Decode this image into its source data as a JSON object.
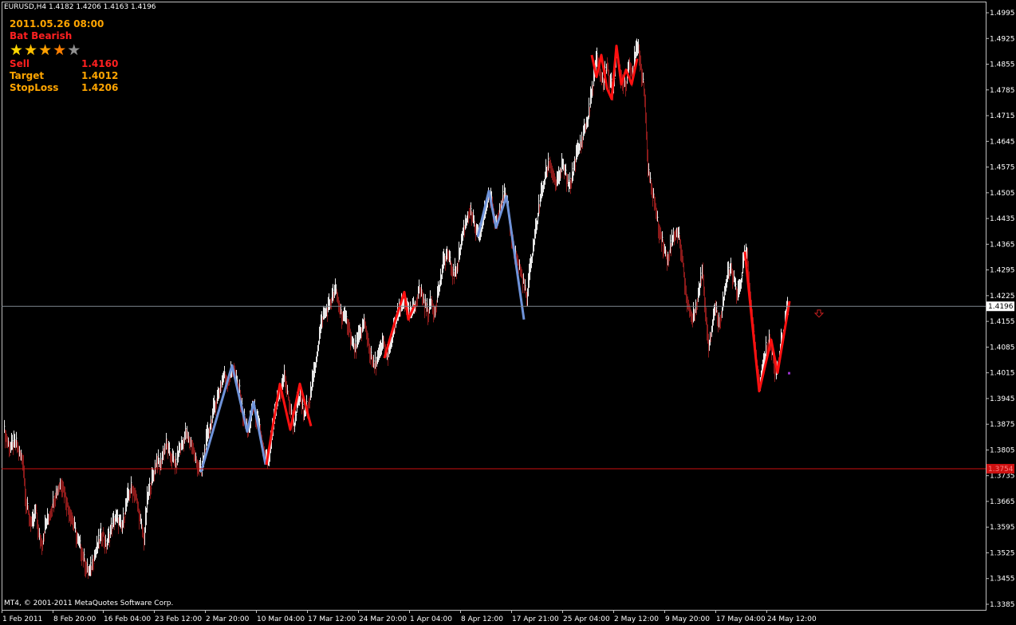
{
  "header": {
    "symbol_line": "EURUSD,H4  1.4182 1.4206 1.4163 1.4196"
  },
  "copyright": "MT4, © 2001-2011 MetaQuotes Software Corp.",
  "panel": {
    "datetime": "2011.05.26 08:00",
    "pattern": "Bat Bearish",
    "stars": [
      {
        "glyph": "★",
        "color": "#ffd700"
      },
      {
        "glyph": "★",
        "color": "#ffc000"
      },
      {
        "glyph": "★",
        "color": "#ffa000"
      },
      {
        "glyph": "★",
        "color": "#ff8000"
      },
      {
        "glyph": "★",
        "color": "#909090"
      }
    ],
    "sell": {
      "label": "Sell",
      "value": "1.4160"
    },
    "target": {
      "label": "Target",
      "value": "1.4012"
    },
    "stoploss": {
      "label": "StopLoss",
      "value": "1.4206"
    }
  },
  "colors": {
    "background": "#000000",
    "axis": "#c0c0c0",
    "text": "#ffffff",
    "bull": "#e8e8e8",
    "bear": "#8b1a1a",
    "pattern_blue": "#6f93d9",
    "pattern_red": "#ff1010",
    "current_price_line": "#7f8790",
    "level_line": "#cc1010",
    "level_label_bg": "#cc1010",
    "signal_arrow": "#c82020",
    "dot": "#9932cc"
  },
  "chart_data": {
    "type": "line",
    "title": "",
    "ylim": [
      1.338,
      1.5035
    ],
    "y_ticks": [
      "1.4995",
      "1.4925",
      "1.4855",
      "1.4785",
      "1.4715",
      "1.4645",
      "1.4575",
      "1.4505",
      "1.4435",
      "1.4365",
      "1.4295",
      "1.4225",
      "1.4155",
      "1.4085",
      "1.4015",
      "1.3945",
      "1.3875",
      "1.3805",
      "1.3735",
      "1.3665",
      "1.3595",
      "1.3525",
      "1.3455",
      "1.3385"
    ],
    "x_ticks": [
      "1 Feb 2011",
      "8 Feb 20:00",
      "16 Feb 04:00",
      "23 Feb 12:00",
      "2 Mar 20:00",
      "10 Mar 04:00",
      "17 Mar 12:00",
      "24 Mar 20:00",
      "1 Apr 04:00",
      "8 Apr 12:00",
      "17 Apr 21:00",
      "25 Apr 04:00",
      "2 May 12:00",
      "9 May 20:00",
      "17 May 04:00",
      "24 May 12:00"
    ],
    "current_price": {
      "label": "1.4196",
      "value": 1.4196
    },
    "level": {
      "label": "1.3754",
      "value": 1.3754
    },
    "close_path": [
      [
        0,
        1.386
      ],
      [
        4,
        1.383
      ],
      [
        8,
        1.381
      ],
      [
        12,
        1.382
      ],
      [
        16,
        1.382
      ],
      [
        20,
        1.379
      ],
      [
        24,
        1.378
      ],
      [
        28,
        1.366
      ],
      [
        32,
        1.362
      ],
      [
        36,
        1.36
      ],
      [
        40,
        1.364
      ],
      [
        44,
        1.357
      ],
      [
        48,
        1.355
      ],
      [
        52,
        1.36
      ],
      [
        56,
        1.362
      ],
      [
        60,
        1.365
      ],
      [
        64,
        1.368
      ],
      [
        68,
        1.37
      ],
      [
        72,
        1.372
      ],
      [
        76,
        1.369
      ],
      [
        80,
        1.365
      ],
      [
        84,
        1.363
      ],
      [
        88,
        1.36
      ],
      [
        92,
        1.356
      ],
      [
        96,
        1.354
      ],
      [
        100,
        1.351
      ],
      [
        104,
        1.348
      ],
      [
        108,
        1.347
      ],
      [
        112,
        1.351
      ],
      [
        116,
        1.353
      ],
      [
        120,
        1.356
      ],
      [
        124,
        1.358
      ],
      [
        128,
        1.354
      ],
      [
        132,
        1.357
      ],
      [
        136,
        1.36
      ],
      [
        140,
        1.362
      ],
      [
        144,
        1.361
      ],
      [
        148,
        1.359
      ],
      [
        152,
        1.364
      ],
      [
        156,
        1.368
      ],
      [
        160,
        1.37
      ],
      [
        164,
        1.369
      ],
      [
        168,
        1.365
      ],
      [
        172,
        1.36
      ],
      [
        176,
        1.356
      ],
      [
        180,
        1.367
      ],
      [
        184,
        1.371
      ],
      [
        188,
        1.374
      ],
      [
        192,
        1.378
      ],
      [
        196,
        1.376
      ],
      [
        200,
        1.38
      ],
      [
        204,
        1.382
      ],
      [
        208,
        1.379
      ],
      [
        212,
        1.378
      ],
      [
        216,
        1.376
      ],
      [
        220,
        1.381
      ],
      [
        224,
        1.382
      ],
      [
        228,
        1.385
      ],
      [
        232,
        1.383
      ],
      [
        236,
        1.382
      ],
      [
        240,
        1.378
      ],
      [
        244,
        1.376
      ],
      [
        248,
        1.3745
      ],
      [
        252,
        1.38
      ],
      [
        256,
        1.385
      ],
      [
        260,
        1.388
      ],
      [
        264,
        1.392
      ],
      [
        268,
        1.395
      ],
      [
        272,
        1.398
      ],
      [
        276,
        1.401
      ],
      [
        280,
        1.399
      ],
      [
        284,
        1.401
      ],
      [
        288,
        1.403
      ],
      [
        292,
        1.399
      ],
      [
        296,
        1.396
      ],
      [
        300,
        1.39
      ],
      [
        304,
        1.387
      ],
      [
        308,
        1.386
      ],
      [
        312,
        1.393
      ],
      [
        316,
        1.39
      ],
      [
        320,
        1.387
      ],
      [
        324,
        1.382
      ],
      [
        328,
        1.378
      ],
      [
        332,
        1.377
      ],
      [
        336,
        1.384
      ],
      [
        340,
        1.39
      ],
      [
        344,
        1.395
      ],
      [
        348,
        1.397
      ],
      [
        352,
        1.401
      ],
      [
        356,
        1.395
      ],
      [
        360,
        1.391
      ],
      [
        364,
        1.387
      ],
      [
        368,
        1.393
      ],
      [
        372,
        1.395
      ],
      [
        376,
        1.39
      ],
      [
        380,
        1.392
      ],
      [
        384,
        1.395
      ],
      [
        388,
        1.4
      ],
      [
        392,
        1.406
      ],
      [
        396,
        1.412
      ],
      [
        400,
        1.417
      ],
      [
        404,
        1.418
      ],
      [
        408,
        1.42
      ],
      [
        412,
        1.422
      ],
      [
        416,
        1.424
      ],
      [
        420,
        1.42
      ],
      [
        424,
        1.417
      ],
      [
        428,
        1.416
      ],
      [
        432,
        1.415
      ],
      [
        436,
        1.41
      ],
      [
        440,
        1.408
      ],
      [
        444,
        1.41
      ],
      [
        448,
        1.413
      ],
      [
        452,
        1.415
      ],
      [
        456,
        1.411
      ],
      [
        460,
        1.406
      ],
      [
        464,
        1.403
      ],
      [
        468,
        1.405
      ],
      [
        472,
        1.407
      ],
      [
        476,
        1.41
      ],
      [
        480,
        1.406
      ],
      [
        484,
        1.408
      ],
      [
        488,
        1.412
      ],
      [
        492,
        1.416
      ],
      [
        496,
        1.418
      ],
      [
        500,
        1.42
      ],
      [
        504,
        1.421
      ],
      [
        508,
        1.417
      ],
      [
        512,
        1.418
      ],
      [
        516,
        1.42
      ],
      [
        520,
        1.424
      ],
      [
        524,
        1.423
      ],
      [
        528,
        1.42
      ],
      [
        532,
        1.418
      ],
      [
        536,
        1.421
      ],
      [
        540,
        1.418
      ],
      [
        544,
        1.423
      ],
      [
        548,
        1.427
      ],
      [
        552,
        1.432
      ],
      [
        556,
        1.434
      ],
      [
        560,
        1.431
      ],
      [
        564,
        1.428
      ],
      [
        568,
        1.43
      ],
      [
        572,
        1.435
      ],
      [
        576,
        1.44
      ],
      [
        580,
        1.443
      ],
      [
        584,
        1.446
      ],
      [
        588,
        1.443
      ],
      [
        592,
        1.44
      ],
      [
        596,
        1.438
      ],
      [
        600,
        1.442
      ],
      [
        604,
        1.446
      ],
      [
        608,
        1.45
      ],
      [
        612,
        1.448
      ],
      [
        616,
        1.442
      ],
      [
        620,
        1.445
      ],
      [
        624,
        1.448
      ],
      [
        628,
        1.45
      ],
      [
        632,
        1.446
      ],
      [
        636,
        1.44
      ],
      [
        640,
        1.435
      ],
      [
        644,
        1.432
      ],
      [
        648,
        1.429
      ],
      [
        652,
        1.426
      ],
      [
        656,
        1.421
      ],
      [
        660,
        1.43
      ],
      [
        664,
        1.436
      ],
      [
        668,
        1.442
      ],
      [
        672,
        1.448
      ],
      [
        676,
        1.452
      ],
      [
        680,
        1.456
      ],
      [
        684,
        1.459
      ],
      [
        688,
        1.456
      ],
      [
        692,
        1.453
      ],
      [
        696,
        1.454
      ],
      [
        700,
        1.458
      ],
      [
        704,
        1.456
      ],
      [
        708,
        1.452
      ],
      [
        712,
        1.454
      ],
      [
        716,
        1.459
      ],
      [
        720,
        1.462
      ],
      [
        724,
        1.464
      ],
      [
        728,
        1.468
      ],
      [
        732,
        1.47
      ],
      [
        736,
        1.476
      ],
      [
        740,
        1.482
      ],
      [
        744,
        1.487
      ],
      [
        748,
        1.483
      ],
      [
        752,
        1.48
      ],
      [
        756,
        1.486
      ],
      [
        760,
        1.48
      ],
      [
        764,
        1.479
      ],
      [
        768,
        1.488
      ],
      [
        772,
        1.484
      ],
      [
        776,
        1.481
      ],
      [
        780,
        1.48
      ],
      [
        784,
        1.486
      ],
      [
        788,
        1.483
      ],
      [
        792,
        1.488
      ],
      [
        796,
        1.49
      ],
      [
        800,
        1.483
      ],
      [
        804,
        1.476
      ],
      [
        808,
        1.456
      ],
      [
        812,
        1.452
      ],
      [
        816,
        1.448
      ],
      [
        820,
        1.442
      ],
      [
        824,
        1.439
      ],
      [
        828,
        1.435
      ],
      [
        832,
        1.432
      ],
      [
        836,
        1.436
      ],
      [
        840,
        1.439
      ],
      [
        844,
        1.44
      ],
      [
        848,
        1.437
      ],
      [
        852,
        1.43
      ],
      [
        856,
        1.422
      ],
      [
        860,
        1.418
      ],
      [
        864,
        1.416
      ],
      [
        868,
        1.42
      ],
      [
        872,
        1.424
      ],
      [
        876,
        1.43
      ],
      [
        880,
        1.418
      ],
      [
        884,
        1.409
      ],
      [
        888,
        1.414
      ],
      [
        892,
        1.42
      ],
      [
        896,
        1.415
      ],
      [
        900,
        1.418
      ],
      [
        904,
        1.424
      ],
      [
        908,
        1.428
      ],
      [
        912,
        1.43
      ],
      [
        916,
        1.426
      ],
      [
        920,
        1.422
      ],
      [
        924,
        1.426
      ],
      [
        928,
        1.433
      ],
      [
        932,
        1.434
      ],
      [
        936,
        1.422
      ],
      [
        940,
        1.413
      ],
      [
        944,
        1.404
      ],
      [
        948,
        1.398
      ],
      [
        952,
        1.403
      ],
      [
        956,
        1.408
      ],
      [
        960,
        1.411
      ],
      [
        964,
        1.406
      ],
      [
        968,
        1.401
      ],
      [
        972,
        1.406
      ],
      [
        976,
        1.411
      ],
      [
        980,
        1.416
      ],
      [
        984,
        1.4196
      ]
    ],
    "blue_pattern_1": [
      [
        248,
        1.3745
      ],
      [
        287,
        1.4035
      ],
      [
        306,
        1.3855
      ],
      [
        314,
        1.3935
      ],
      [
        329,
        1.3765
      ]
    ],
    "blue_pattern_2": [
      [
        595,
        1.4385
      ],
      [
        609,
        1.451
      ],
      [
        618,
        1.441
      ],
      [
        631,
        1.4495
      ],
      [
        653,
        1.416
      ]
    ],
    "red_pattern_1": [
      [
        330,
        1.3765
      ],
      [
        347,
        1.3985
      ],
      [
        360,
        1.386
      ],
      [
        372,
        1.3985
      ],
      [
        386,
        1.387
      ]
    ],
    "red_pattern_2": [
      [
        478,
        1.4055
      ],
      [
        492,
        1.416
      ],
      [
        503,
        1.4235
      ],
      [
        508,
        1.416
      ],
      [
        516,
        1.42
      ]
    ],
    "red_pattern_3": [
      [
        738,
        1.488
      ],
      [
        744,
        1.482
      ],
      [
        750,
        1.488
      ],
      [
        757,
        1.479
      ],
      [
        763,
        1.476
      ],
      [
        769,
        1.4905
      ],
      [
        775,
        1.48
      ],
      [
        781,
        1.484
      ],
      [
        788,
        1.48
      ],
      [
        795,
        1.487
      ]
    ],
    "red_pattern_4": [
      [
        930,
        1.4345
      ],
      [
        948,
        1.3965
      ],
      [
        963,
        1.4105
      ],
      [
        971,
        1.4015
      ],
      [
        986,
        1.421
      ]
    ],
    "signal_arrow": [
      1027,
      1.4186
    ],
    "dot": [
      985,
      1.4015
    ]
  }
}
